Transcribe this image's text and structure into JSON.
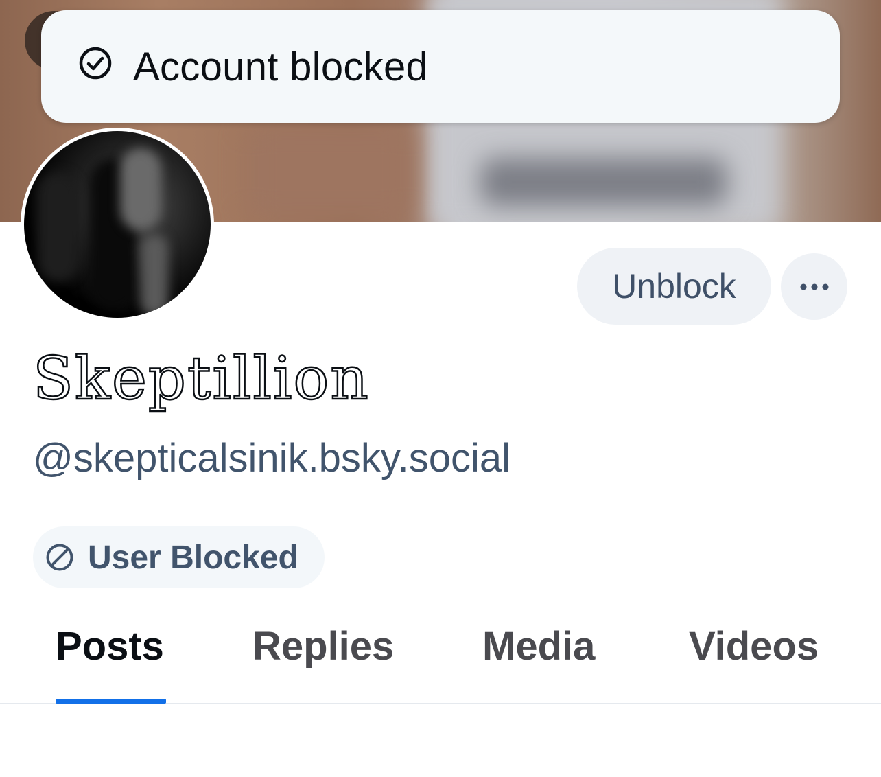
{
  "toast": {
    "icon": "check-circle-icon",
    "message": "Account blocked"
  },
  "profile": {
    "display_name": "Skeptillion",
    "handle": "@skepticalsinik.bsky.social",
    "status_badge": {
      "icon": "ban-icon",
      "label": "User Blocked"
    }
  },
  "actions": {
    "unblock_label": "Unblock",
    "more_icon": "ellipsis-icon"
  },
  "tabs": [
    {
      "label": "Posts",
      "active": true
    },
    {
      "label": "Replies",
      "active": false
    },
    {
      "label": "Media",
      "active": false
    },
    {
      "label": "Videos",
      "active": false
    }
  ],
  "colors": {
    "accent": "#1270e8",
    "secondary_text": "#41546c",
    "button_bg": "#eff2f6",
    "toast_bg": "#f4f8fa"
  }
}
